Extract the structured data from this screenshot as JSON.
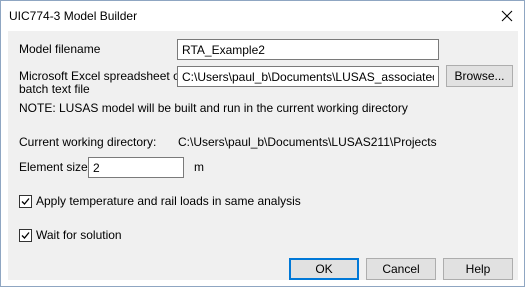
{
  "window": {
    "title": "UIC774-3 Model Builder",
    "close_icon": "close-icon"
  },
  "form": {
    "model_filename_label": "Model filename",
    "model_filename_value": "RTA_Example2",
    "excel_label_line1": "Microsoft Excel spreadsheet or",
    "excel_label_line2": "batch text file",
    "excel_path_value": "C:\\Users\\paul_b\\Documents\\LUSAS_associated_examp",
    "browse_label": "Browse...",
    "note": "NOTE: LUSAS model will be built and run in the current working directory",
    "cwd_label": "Current working directory:",
    "cwd_value": "C:\\Users\\paul_b\\Documents\\LUSAS211\\Projects",
    "element_size_label": "Element size",
    "element_size_value": "2",
    "element_size_unit": "m",
    "apply_loads_label": "Apply temperature and rail loads in same analysis",
    "apply_loads_checked": true,
    "wait_label": "Wait for solution",
    "wait_checked": true
  },
  "buttons": {
    "ok": "OK",
    "cancel": "Cancel",
    "help": "Help"
  },
  "colors": {
    "client_bg": "#f0f0f0",
    "default_button_border": "#0078d7"
  }
}
